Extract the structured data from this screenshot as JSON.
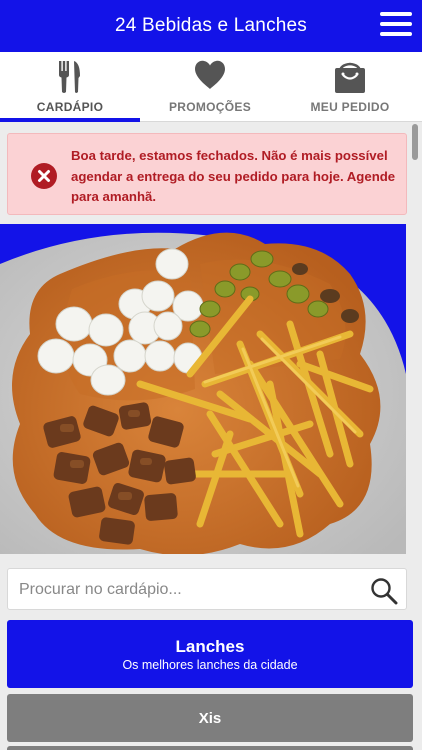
{
  "header": {
    "title": "24 Bebidas e Lanches",
    "menu_icon": "hamburger-menu-icon"
  },
  "tabs": [
    {
      "label": "CARDÁPIO",
      "icon": "fork-knife-icon",
      "active": true
    },
    {
      "label": "PROMOÇÕES",
      "icon": "heart-icon",
      "active": false
    },
    {
      "label": "MEU PEDIDO",
      "icon": "shopping-bag-icon",
      "active": false
    }
  ],
  "alert": {
    "icon": "error-x-icon",
    "message": "Boa tarde, estamos fechados. Não é mais possível agendar a entrega do seu pedido para hoje. Agende para amanhã."
  },
  "search": {
    "placeholder": "Procurar no cardápio...",
    "icon": "search-icon"
  },
  "categories": [
    {
      "name": "Lanches",
      "subtitle": "Os melhores lanches da cidade"
    },
    {
      "name": "Xis",
      "subtitle": ""
    }
  ],
  "colors": {
    "brand": "#1313e8",
    "alert_bg": "#fbd2d4",
    "alert_text": "#b01c24",
    "category_gray": "#7e7e7e"
  }
}
